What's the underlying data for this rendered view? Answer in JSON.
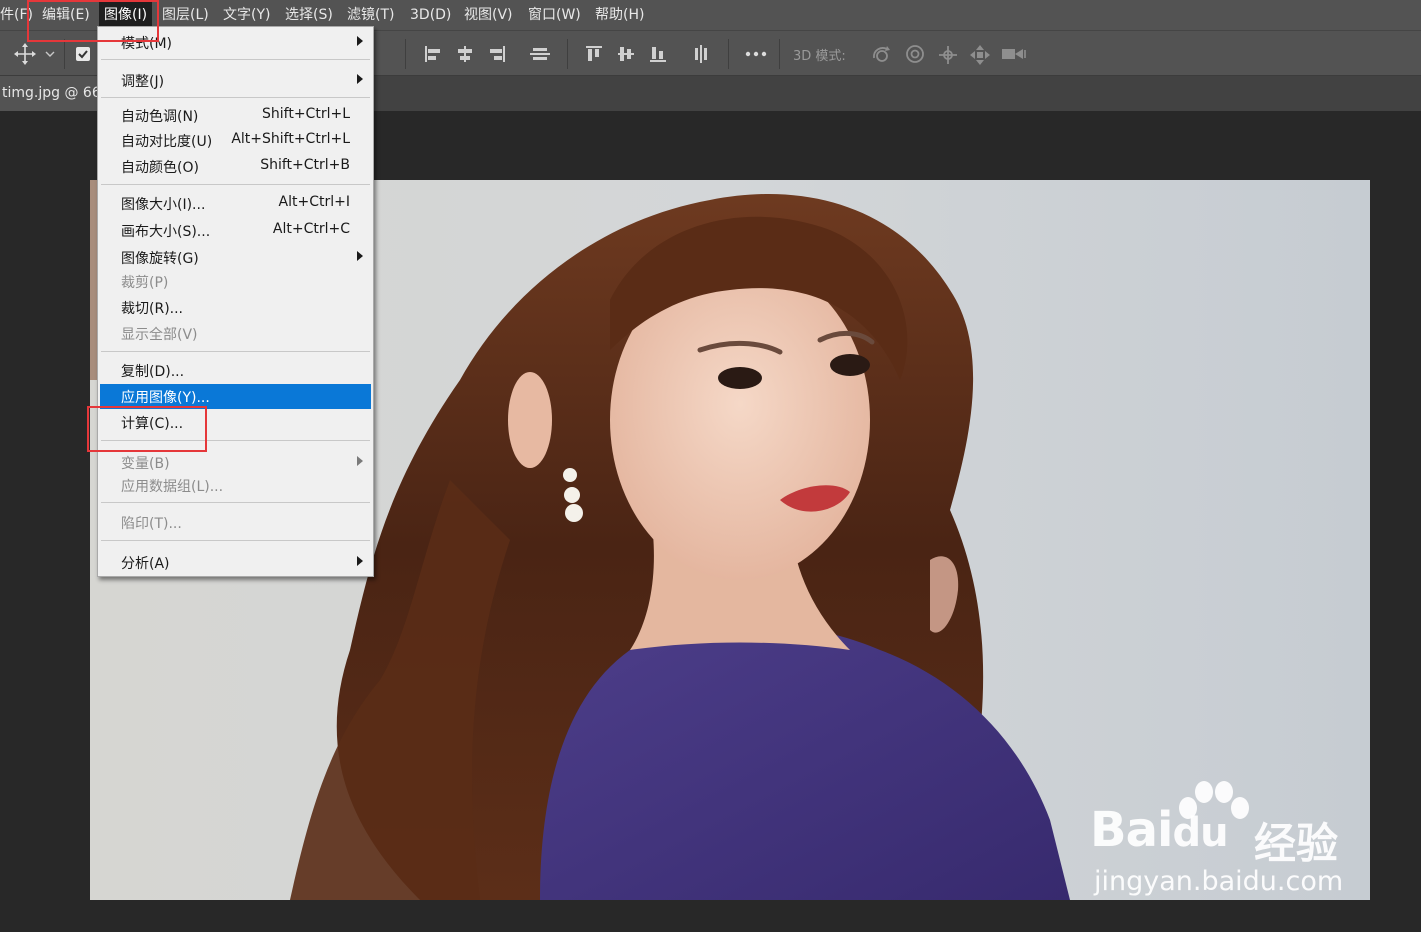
{
  "menubar": {
    "items": [
      {
        "label": "件(F)"
      },
      {
        "label": "编辑(E)"
      },
      {
        "label": "图像(I)"
      },
      {
        "label": "图层(L)"
      },
      {
        "label": "文字(Y)"
      },
      {
        "label": "选择(S)"
      },
      {
        "label": "滤镜(T)"
      },
      {
        "label": "3D(D)"
      },
      {
        "label": "视图(V)"
      },
      {
        "label": "窗口(W)"
      },
      {
        "label": "帮助(H)"
      }
    ]
  },
  "options_bar": {
    "mode_label": "3D 模式:",
    "icons": [
      "move-tool-icon",
      "chevron-down-icon",
      "checkbox-icon",
      "align-left-icon",
      "align-center-icon",
      "align-right-icon",
      "distribute-icon",
      "align-top-icon",
      "align-middle-icon",
      "align-bottom-icon",
      "distribute-vertical-icon",
      "more-icon",
      "3d-rotate-icon",
      "3d-roll-icon",
      "3d-pan-icon",
      "3d-slide-icon",
      "3d-scale-icon"
    ]
  },
  "document": {
    "tab_label": "timg.jpg @ 66."
  },
  "image_menu": {
    "items": [
      {
        "label": "模式(M)"
      },
      {
        "label": "调整(J)"
      },
      {
        "label": "自动色调(N)",
        "shortcut": "Shift+Ctrl+L"
      },
      {
        "label": "自动对比度(U)",
        "shortcut": "Alt+Shift+Ctrl+L"
      },
      {
        "label": "自动颜色(O)",
        "shortcut": "Shift+Ctrl+B"
      },
      {
        "label": "图像大小(I)...",
        "shortcut": "Alt+Ctrl+I"
      },
      {
        "label": "画布大小(S)...",
        "shortcut": "Alt+Ctrl+C"
      },
      {
        "label": "图像旋转(G)"
      },
      {
        "label": "裁剪(P)"
      },
      {
        "label": "裁切(R)..."
      },
      {
        "label": "显示全部(V)"
      },
      {
        "label": "复制(D)..."
      },
      {
        "label": "应用图像(Y)..."
      },
      {
        "label": "计算(C)..."
      },
      {
        "label": "变量(B)"
      },
      {
        "label": "应用数据组(L)..."
      },
      {
        "label": "陷印(T)..."
      },
      {
        "label": "分析(A)"
      }
    ]
  },
  "watermark": {
    "brand": "Bai",
    "brand_du": "du",
    "brand_cn": "经验",
    "url": "jingyan.baidu.com"
  },
  "colors": {
    "menubar_bg": "#535353",
    "canvas_bg": "#282828",
    "menu_bg": "#f0f0f0",
    "highlight": "#0a78d7",
    "annotation_red": "#e5373a"
  }
}
